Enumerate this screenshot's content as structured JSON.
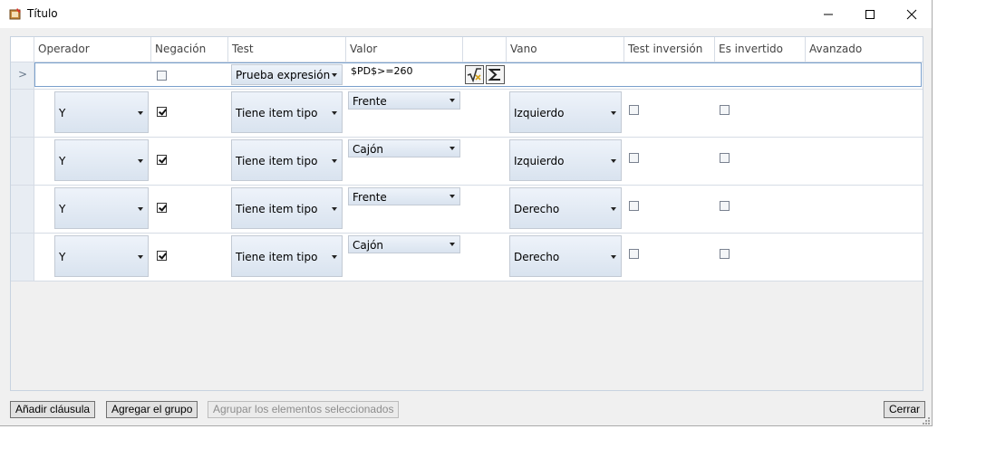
{
  "window": {
    "title": "Título"
  },
  "grid": {
    "columns": [
      "Operador",
      "Negación",
      "Test",
      "Valor",
      "",
      "Vano",
      "Test inversión",
      "Es invertido",
      "Avanzado"
    ],
    "header_row": {
      "indicator": ">",
      "negation_checked": false,
      "test": "Prueba expresión",
      "value": "$PD$>=260"
    },
    "rows": [
      {
        "operator": "Y",
        "negation_checked": true,
        "test": "Tiene item tipo",
        "value": "Frente",
        "vano": "Izquierdo",
        "test_inversion": false,
        "es_invertido": false
      },
      {
        "operator": "Y",
        "negation_checked": true,
        "test": "Tiene item tipo",
        "value": "Cajón",
        "vano": "Izquierdo",
        "test_inversion": false,
        "es_invertido": false
      },
      {
        "operator": "Y",
        "negation_checked": true,
        "test": "Tiene item tipo",
        "value": "Frente",
        "vano": "Derecho",
        "test_inversion": false,
        "es_invertido": false
      },
      {
        "operator": "Y",
        "negation_checked": true,
        "test": "Tiene item tipo",
        "value": "Cajón",
        "vano": "Derecho",
        "test_inversion": false,
        "es_invertido": false
      }
    ]
  },
  "buttons": {
    "add_clause": "Añadir cláusula",
    "add_group": "Agregar el grupo",
    "group_selected": "Agrupar los elementos seleccionados",
    "close": "Cerrar"
  },
  "icons": [
    "app-icon",
    "minimize-icon",
    "maximize-icon",
    "close-icon",
    "formula-icon",
    "sum-icon",
    "dropdown-arrow-icon"
  ]
}
